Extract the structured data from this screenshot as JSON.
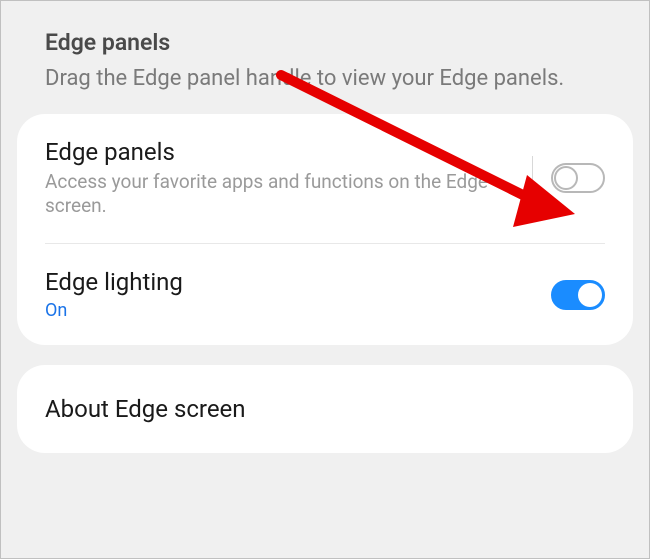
{
  "header": {
    "title": "Edge panels",
    "subtitle": "Drag the Edge panel handle to view your Edge panels."
  },
  "settings": {
    "edge_panels": {
      "title": "Edge panels",
      "subtitle": "Access your favorite apps and functions on the Edge screen.",
      "enabled": false
    },
    "edge_lighting": {
      "title": "Edge lighting",
      "status": "On",
      "enabled": true
    },
    "about": {
      "title": "About Edge screen"
    }
  },
  "annotation": {
    "arrow_color": "#e60000"
  }
}
